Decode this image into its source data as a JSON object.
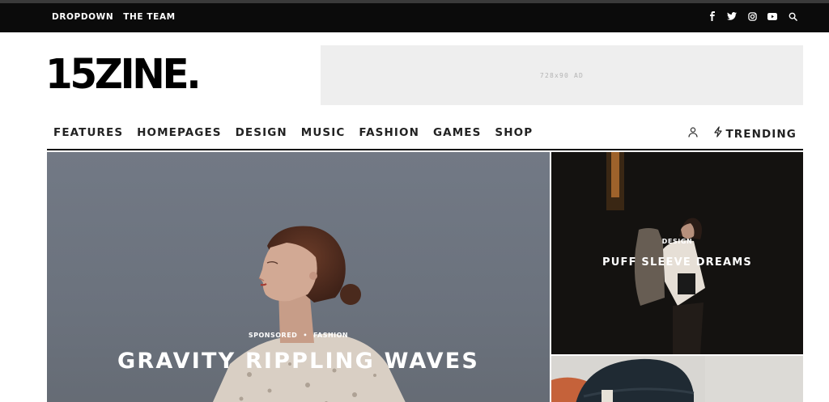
{
  "topbar": {
    "links": [
      "DROPDOWN",
      "THE TEAM"
    ],
    "social_icons": [
      "facebook-icon",
      "twitter-icon",
      "instagram-icon",
      "youtube-icon",
      "search-icon"
    ]
  },
  "logo": "15ZINE.",
  "ad": {
    "label": "728x90 AD"
  },
  "nav": {
    "items": [
      "FEATURES",
      "HOMEPAGES",
      "DESIGN",
      "MUSIC",
      "FASHION",
      "GAMES",
      "SHOP"
    ],
    "user_icon": "user-icon",
    "trending_icon": "lightning-icon",
    "trending_label": "TRENDING"
  },
  "hero": {
    "tag1": "SPONSORED",
    "separator": "•",
    "tag2": "FASHION",
    "title": "GRAVITY RIPPLING WAVES"
  },
  "side_cards": [
    {
      "category": "DESIGN",
      "title": "PUFF SLEEVE DREAMS"
    },
    {
      "category": "",
      "title": ""
    }
  ],
  "colors": {
    "topbar_bg": "#0b0b0b",
    "ad_bg": "#eeeeee",
    "text_dark": "#222222"
  }
}
